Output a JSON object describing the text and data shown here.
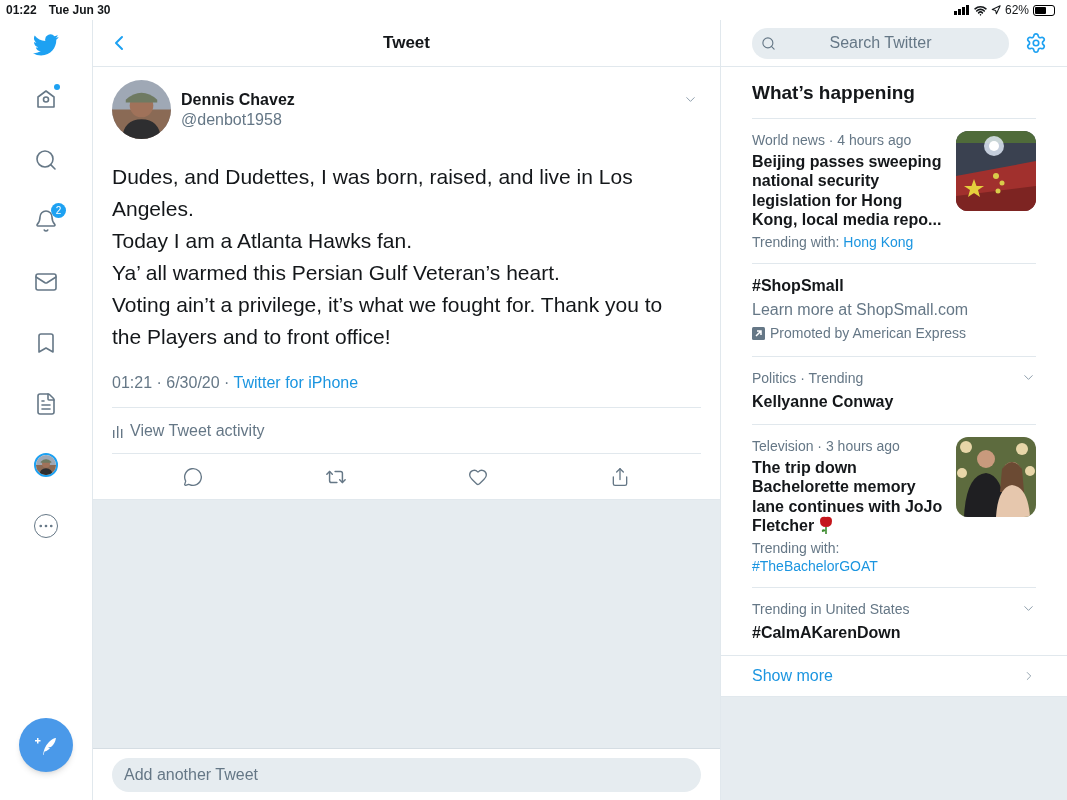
{
  "status_bar": {
    "time": "01:22",
    "date": "Tue Jun 30",
    "battery": "62%"
  },
  "sidebar": {
    "items": [
      {
        "kind": "logo"
      },
      {
        "kind": "home",
        "unread": true
      },
      {
        "kind": "search"
      },
      {
        "kind": "notifications",
        "badge": "2"
      },
      {
        "kind": "messages"
      },
      {
        "kind": "bookmarks"
      },
      {
        "kind": "lists"
      },
      {
        "kind": "profile"
      },
      {
        "kind": "more"
      }
    ]
  },
  "header": {
    "title": "Tweet"
  },
  "tweet": {
    "name": "Dennis Chavez",
    "handle": "@denbot1958",
    "paragraphs": [
      "Dudes, and Dudettes, I was born, raised, and live in Los Angeles.",
      "Today I am a Atlanta Hawks fan.",
      "Ya’ all warmed this Persian Gulf Veteran’s heart.",
      "Voting ain’t a privilege, it’s what we fought for.  Thank you to the Players and to front office!"
    ],
    "timestamp": "01:21 · 6/30/20 · ",
    "source": "Twitter for iPhone",
    "activity": "View Tweet activity"
  },
  "reply": {
    "placeholder": "Add another Tweet"
  },
  "search": {
    "placeholder": "Search Twitter"
  },
  "trends": {
    "title": "What’s happening",
    "items": [
      {
        "kind": "news",
        "meta": "World news · 4 hours ago",
        "headline": "Beijing passes sweeping national security legislation for Hong Kong, local media repo...",
        "trending_label": "Trending with: ",
        "trending_with": "Hong Kong",
        "has_picture": true
      },
      {
        "kind": "promoted",
        "title": "#ShopSmall",
        "description": "Learn more at ShopSmall.com",
        "promoted": "Promoted by American Express"
      },
      {
        "kind": "trend",
        "meta": "Politics · Trending",
        "title": "Kellyanne Conway"
      },
      {
        "kind": "news",
        "meta": "Television · 3 hours ago",
        "headline": "The trip down Bachelorette memory lane continues with JoJo Fletcher",
        "rose_icon": true,
        "trending_label": "Trending with: ",
        "trending_with": "#TheBachelorGOAT",
        "has_picture": true
      },
      {
        "kind": "trend",
        "meta": "Trending in United States",
        "title": "#CalmAKarenDown"
      }
    ],
    "show_more": "Show more"
  }
}
